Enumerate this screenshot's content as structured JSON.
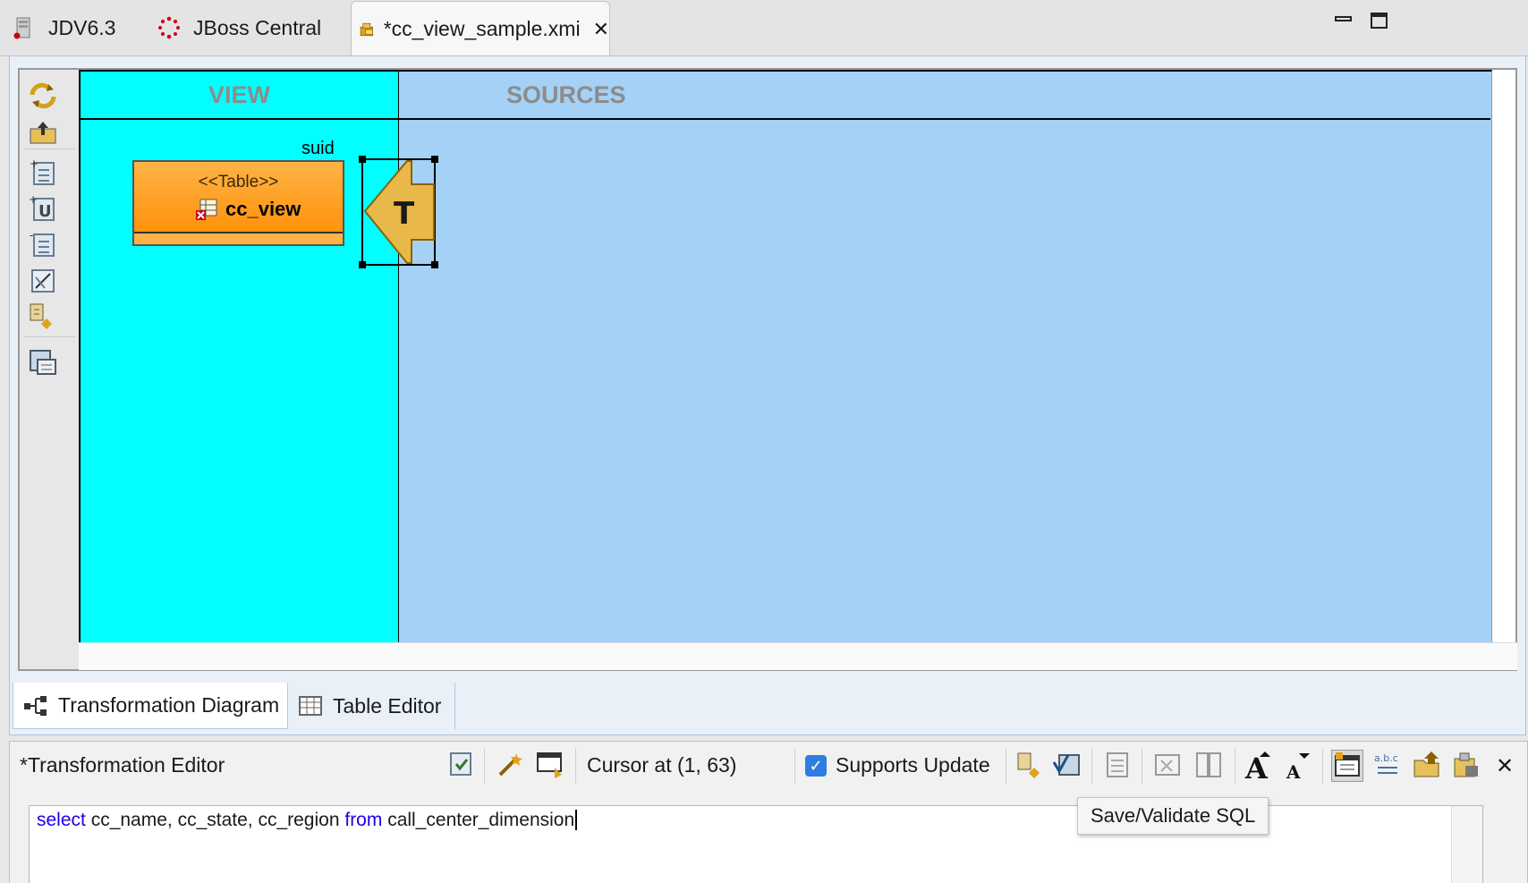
{
  "editor_tabs": [
    {
      "label": "JDV6.3",
      "icon": "server-icon"
    },
    {
      "label": "JBoss Central",
      "icon": "jboss-icon"
    },
    {
      "label": "*cc_view_sample.xmi",
      "icon": "model-package-icon",
      "active": true
    }
  ],
  "window_controls": [
    "minimize-icon",
    "maximize-icon"
  ],
  "palette_icons": [
    "refresh-diagram-icon",
    "up-package-icon",
    "add-source-icon",
    "add-union-icon",
    "remove-source-icon",
    "edit-mapping-icon",
    "reconcile-icon",
    "save-diagram-icon"
  ],
  "diagram": {
    "view_header": "VIEW",
    "sources_header": "SOURCES",
    "table_node": {
      "stereotype": "<<Table>>",
      "name": "cc_view",
      "annotation": "suid"
    },
    "transform_node": {
      "letter": "T",
      "icon": "transformation-arrow-icon"
    }
  },
  "bottom_tabs": [
    {
      "label": "Transformation Diagram",
      "icon": "diagram-tree-icon",
      "active": true
    },
    {
      "label": "Table Editor",
      "icon": "table-grid-icon"
    }
  ],
  "transformation_editor": {
    "title": "*Transformation Editor",
    "cursor_status": "Cursor at (1, 63)",
    "supports_update_label": "Supports Update",
    "supports_update_checked": true,
    "sql": {
      "kw_select": "select",
      "cols": "cc_name, cc_state, cc_region",
      "kw_from": "from",
      "table": "call_center_dimension"
    },
    "tooltip": "Save/Validate SQL",
    "toolbar_icons": [
      "validate-icon",
      "wizard-icon",
      "preview-icon",
      "reconcile-icon",
      "save-validate-sql-icon",
      "criteria-builder-icon",
      "expression-builder-icon",
      "sql-format-icon",
      "font-increase-icon",
      "font-decrease-icon",
      "show-sql-editor-icon",
      "optimize-sql-icon",
      "import-sql-icon",
      "export-sql-icon",
      "close-icon"
    ]
  },
  "colors": {
    "view_bg": "#00ffff",
    "sources_bg": "#a4d1f5",
    "table_node": "#ff9f1c",
    "keyword": "#1f00e6"
  }
}
